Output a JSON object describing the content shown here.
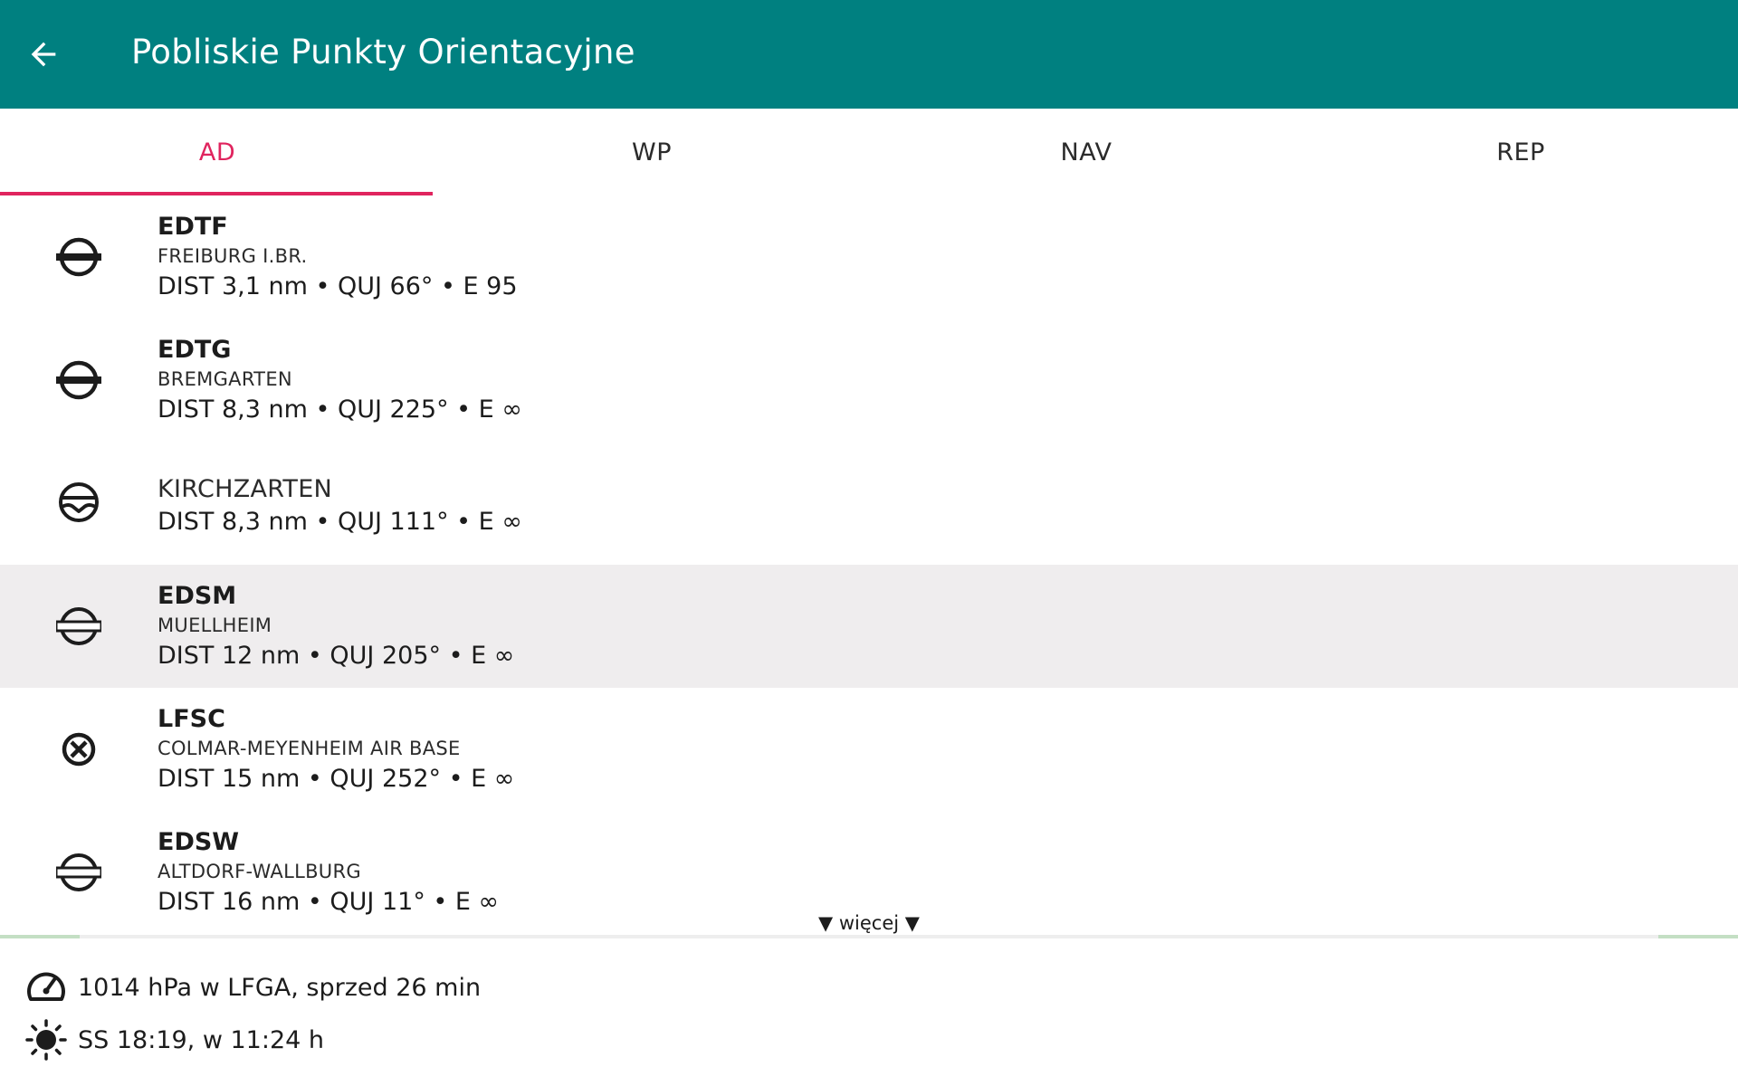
{
  "header": {
    "title": "Pobliskie Punkty Orientacyjne"
  },
  "tabs": [
    {
      "label": "AD",
      "active": true
    },
    {
      "label": "WP",
      "active": false
    },
    {
      "label": "NAV",
      "active": false
    },
    {
      "label": "REP",
      "active": false
    }
  ],
  "waypoints": [
    {
      "icon": "airfield-icon",
      "code": "EDTF",
      "name": "FREIBURG I.BR.",
      "info": "DIST 3,1 nm • QUJ 66° • E 95"
    },
    {
      "icon": "airfield-icon",
      "code": "EDTG",
      "name": "BREMGARTEN",
      "info": "DIST 8,3 nm • QUJ 225° • E ∞"
    },
    {
      "icon": "glider-site-icon",
      "code": "",
      "name": "KIRCHZARTEN",
      "info": "DIST 8,3 nm • QUJ 111° • E ∞"
    },
    {
      "icon": "grass-airfield-icon",
      "code": "EDSM",
      "name": "MUELLHEIM",
      "info": "DIST 12 nm • QUJ 205° • E ∞",
      "selected": true
    },
    {
      "icon": "military-airfield-icon",
      "code": "LFSC",
      "name": "COLMAR-MEYENHEIM AIR BASE",
      "info": "DIST 15 nm • QUJ 252° • E ∞"
    },
    {
      "icon": "grass-airfield-icon",
      "code": "EDSW",
      "name": "ALTDORF-WALLBURG",
      "info": "DIST 16 nm • QUJ 11° • E ∞"
    }
  ],
  "more_label": "▼ więcej ▼",
  "status": {
    "pressure": {
      "icon": "speedometer-icon",
      "text": "1014 hPa w LFGA, sprzed 26 min"
    },
    "sun": {
      "icon": "sun-icon",
      "text": "SS 18:19, w 11:24 h"
    }
  },
  "colors": {
    "appbar": "#008080",
    "accent": "#e0245e",
    "selected_row": "#efedee"
  }
}
